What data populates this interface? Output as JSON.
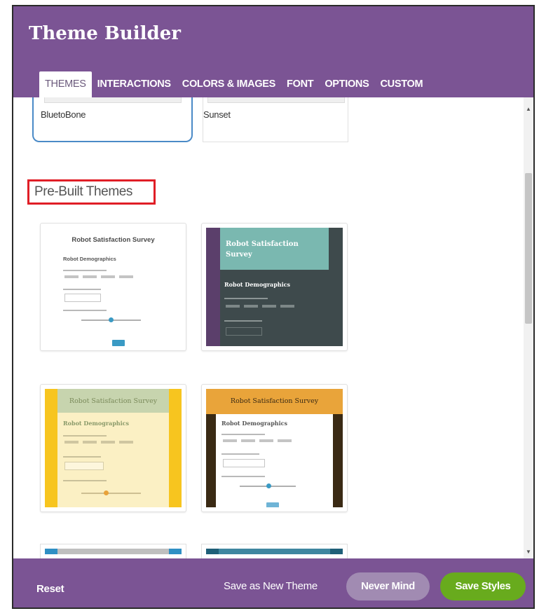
{
  "header": {
    "title": "Theme Builder",
    "tabs": [
      {
        "label": "THEMES",
        "active": true
      },
      {
        "label": "INTERACTIONS",
        "active": false
      },
      {
        "label": "COLORS & IMAGES",
        "active": false
      },
      {
        "label": "FONT",
        "active": false
      },
      {
        "label": "OPTIONS",
        "active": false
      },
      {
        "label": "CUSTOM",
        "active": false
      }
    ]
  },
  "saved_themes": [
    {
      "label": "BluetoBone",
      "selected": true
    },
    {
      "label": "Sunset",
      "selected": false
    }
  ],
  "prebuilt": {
    "heading": "Pre-Built Themes",
    "themes": [
      {
        "preview_title": "Robot Satisfaction Survey",
        "preview_subtitle": "Robot Demographics",
        "style": "plain"
      },
      {
        "preview_title": "Robot Satisfaction Survey",
        "preview_subtitle": "Robot Demographics",
        "style": "dark-teal"
      },
      {
        "preview_title": "Robot Satisfaction Survey",
        "preview_subtitle": "Robot Demographics",
        "style": "yellow-green"
      },
      {
        "preview_title": "Robot Satisfaction Survey",
        "preview_subtitle": "Robot Demographics",
        "style": "orange-wood"
      }
    ]
  },
  "footer": {
    "reset_label": "Reset",
    "save_new_label": "Save as New Theme",
    "never_mind_label": "Never Mind",
    "save_styles_label": "Save Styles"
  },
  "icons": {
    "scroll_up": "scroll-up-arrow-icon",
    "scroll_down": "scroll-down-arrow-icon"
  },
  "colors": {
    "header_purple": "#7b5494",
    "never_mind_bg": "#a18bb2",
    "save_styles_bg": "#68ab1d",
    "selected_border": "#4a8ac7",
    "highlight_red": "#e01e26"
  }
}
